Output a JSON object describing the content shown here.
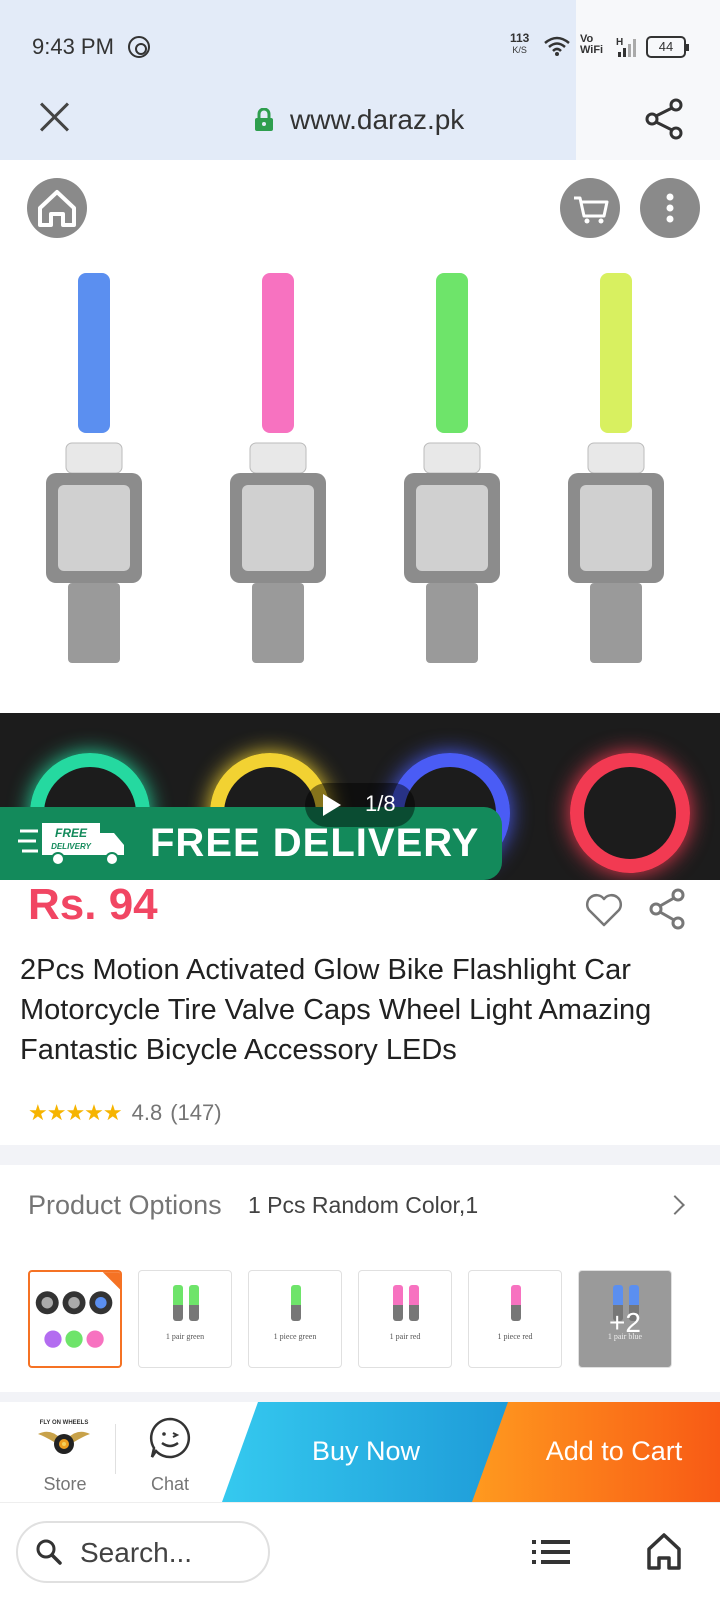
{
  "status_bar": {
    "time": "9:43 PM",
    "speed_value": "113",
    "speed_unit": "K/S",
    "vowifi_line1": "Vo",
    "vowifi_line2": "WiFi",
    "network_type": "H",
    "battery": "44",
    "icons": [
      "whatsapp-icon",
      "wifi-icon",
      "signal-icon",
      "battery-icon"
    ]
  },
  "browser": {
    "url": "www.daraz.pk",
    "icons": [
      "close-icon",
      "lock-icon",
      "share-icon"
    ]
  },
  "page_actions": {
    "icons": [
      "home-icon",
      "cart-icon",
      "more-vertical-icon"
    ]
  },
  "product": {
    "image_counter": "1/8",
    "banner_badge_line1": "FREE",
    "banner_badge_line2": "DELIVERY",
    "banner_text": "FREE DELIVERY",
    "price": "Rs. 94",
    "title": "2Pcs Motion Activated Glow Bike Flashlight Car Motorcycle Tire Valve Caps Wheel Light Amazing Fantastic Bicycle Accessory LEDs",
    "rating_stars": "★★★★★",
    "rating_value": "4.8",
    "rating_count": "(147)",
    "valve_colors": [
      "#5b8ff0",
      "#f772c0",
      "#6ee46a",
      "#d8f060"
    ],
    "wheel_colors": [
      "#25d9a0",
      "#f2d232",
      "#4a5cf5",
      "#f23a52"
    ]
  },
  "options": {
    "label": "Product Options",
    "value": "1 Pcs Random Color,1",
    "thumbnails": [
      {
        "caption": "",
        "color": ""
      },
      {
        "caption": "1 pair green",
        "color": "#6ee46a"
      },
      {
        "caption": "1 piece green",
        "color": "#6ee46a"
      },
      {
        "caption": "1 pair red",
        "color": "#f772c0"
      },
      {
        "caption": "1 piece red",
        "color": "#f772c0"
      },
      {
        "caption": "1 pair blue",
        "color": "#5b8ff0"
      }
    ],
    "more_count": "+2"
  },
  "action_bar": {
    "store_label": "Store",
    "store_logo_text": "FLY ON WHEELS",
    "chat_label": "Chat",
    "buy_now": "Buy Now",
    "add_to_cart": "Add to Cart"
  },
  "bottom_bar": {
    "search_placeholder": "Search..."
  },
  "colors": {
    "price": "#f14663",
    "buy_now": "#1e9bd8",
    "add_to_cart": "#f85a15",
    "banner": "#138a5b",
    "accent_border": "#f57224"
  }
}
